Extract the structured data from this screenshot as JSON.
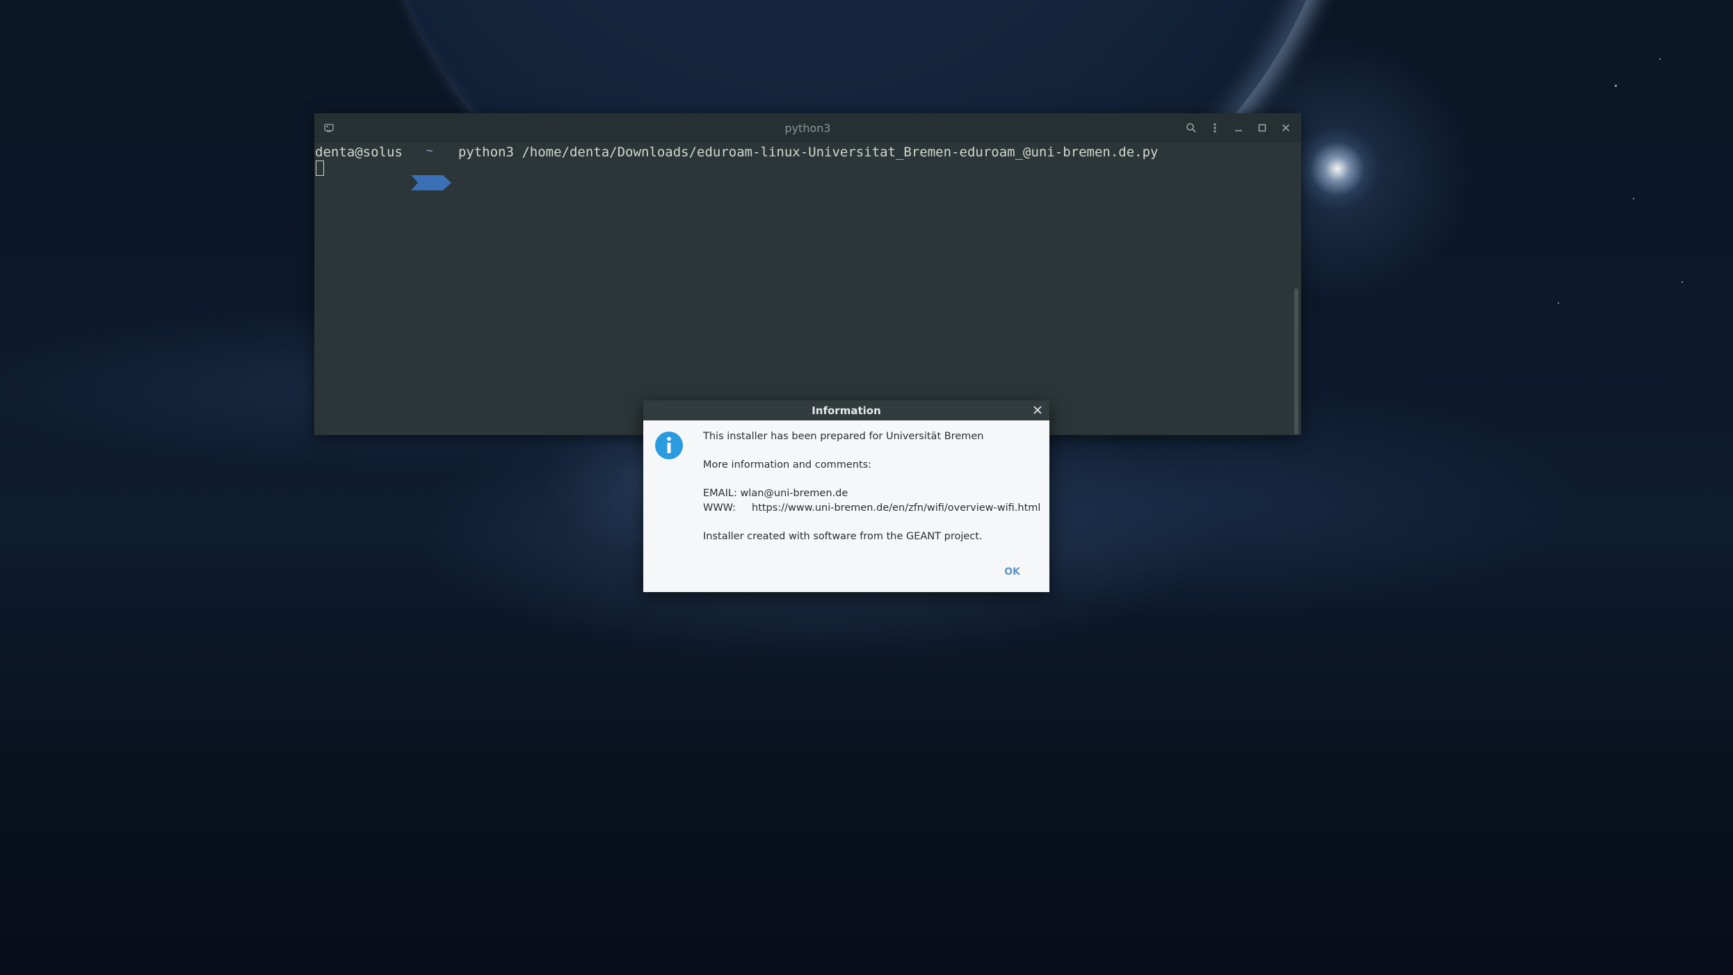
{
  "terminal": {
    "title": "python3",
    "prompt_user": "denta@solus",
    "prompt_dir": "~",
    "command": "python3 /home/denta/Downloads/eduroam-linux-Universitat_Bremen-eduroam_@uni-bremen.de.py"
  },
  "dialog": {
    "title": "Information",
    "line1": "This installer has been prepared for Universität Bremen",
    "line2": "More information and comments:",
    "email_line": "EMAIL: wlan@uni-bremen.de",
    "www_label": "WWW:",
    "www_url": "https://www.uni-bremen.de/en/zfn/wifi/overview-wifi.html",
    "footer": "Installer created with software from the GEANT project.",
    "ok_label": "OK"
  },
  "colors": {
    "terminal_bg": "#2c3638",
    "prompt_arrow": "#3b6fb6",
    "dialog_bg": "#f5f7f8",
    "info_icon": "#2b9be0",
    "ok_text": "#5e96c9"
  },
  "icons": {
    "terminal_window": "terminal-window-icon",
    "search": "search-icon",
    "menu": "kebab-menu-icon",
    "minimize": "minimize-icon",
    "maximize": "maximize-icon",
    "close": "close-icon",
    "info": "info-icon"
  }
}
